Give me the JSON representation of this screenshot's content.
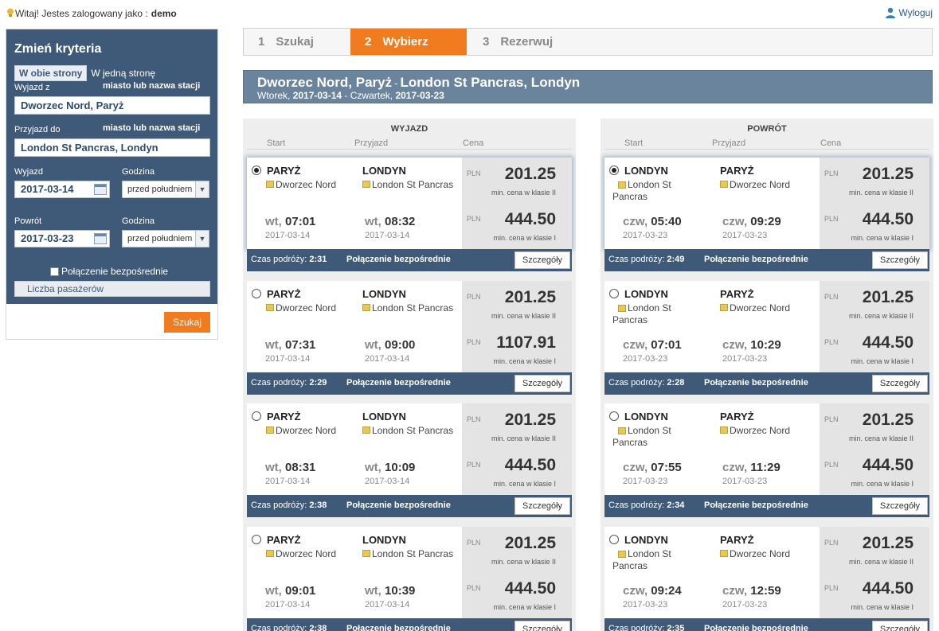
{
  "user_bar": {
    "welcome": "Witaj! Jestes zalogowany jako :",
    "username": "demo",
    "logout": "Wyloguj"
  },
  "sidebar": {
    "title": "Zmień kryteria",
    "trip_round": "W obie strony",
    "trip_oneway": "W jedną stronę",
    "from_label": "Wyjazd z",
    "from_hint": "miasto lub nazwa stacji",
    "from_value": "Dworzec Nord, Paryż",
    "to_label": "Przyjazd do",
    "to_hint": "miasto lub nazwa stacji",
    "to_value": "London St Pancras, Londyn",
    "depart_label": "Wyjazd",
    "depart_date": "2017-03-14",
    "depart_time_label": "Godzina",
    "depart_time": "przed południem",
    "return_label": "Powrót",
    "return_date": "2017-03-23",
    "return_time_label": "Godzina",
    "return_time": "przed południem",
    "direct_label": "Połączenie bezpośrednie",
    "passengers": "Liczba pasażerów",
    "search_button": "Szukaj"
  },
  "steps": [
    {
      "num": "1",
      "label": "Szukaj"
    },
    {
      "num": "2",
      "label": "Wybierz"
    },
    {
      "num": "3",
      "label": "Rezerwuj"
    }
  ],
  "route": {
    "from": "Dworzec Nord, Paryż",
    "sep": "-",
    "to": "London St Pancras, Londyn",
    "day1": "Wtorek,",
    "date1": "2017-03-14",
    "dash": "-",
    "day2": "Czwartek,",
    "date2": "2017-03-23"
  },
  "columns_header": {
    "start": "Start",
    "arrive": "Przyjazd",
    "price": "Cena"
  },
  "outbound": {
    "title": "WYJAZD",
    "from_city": "PARYŻ",
    "to_city": "LONDYN",
    "from_station": "Dworzec Nord",
    "to_station": "London St Pancras",
    "currency": "PLN",
    "class2": "min. cena w klasie II",
    "class1": "min. cena w klasie I",
    "duration_label": "Czas podróży:",
    "direct": "Połączenie bezpośrednie",
    "details": "Szczegóły",
    "trips": [
      {
        "dep_day": "wt,",
        "dep_time": "07:01",
        "dep_date": "2017-03-14",
        "arr_day": "wt,",
        "arr_time": "08:32",
        "arr_date": "2017-03-14",
        "price2": "201.25",
        "price1": "444.50",
        "duration": "2:31",
        "selected": true
      },
      {
        "dep_day": "wt,",
        "dep_time": "07:31",
        "dep_date": "2017-03-14",
        "arr_day": "wt,",
        "arr_time": "09:00",
        "arr_date": "2017-03-14",
        "price2": "201.25",
        "price1": "1107.91",
        "duration": "2:29",
        "selected": false
      },
      {
        "dep_day": "wt,",
        "dep_time": "08:31",
        "dep_date": "2017-03-14",
        "arr_day": "wt,",
        "arr_time": "10:09",
        "arr_date": "2017-03-14",
        "price2": "201.25",
        "price1": "444.50",
        "duration": "2:38",
        "selected": false
      },
      {
        "dep_day": "wt,",
        "dep_time": "09:01",
        "dep_date": "2017-03-14",
        "arr_day": "wt,",
        "arr_time": "10:39",
        "arr_date": "2017-03-14",
        "price2": "201.25",
        "price1": "444.50",
        "duration": "2:38",
        "selected": false
      }
    ]
  },
  "inbound": {
    "title": "POWRÓT",
    "from_city": "LONDYN",
    "to_city": "PARYŻ",
    "from_station_a": "London St",
    "from_station_b": "Pancras",
    "to_station": "Dworzec Nord",
    "currency": "PLN",
    "class2": "min. cena w klasie II",
    "class1": "min. cena w klasie I",
    "duration_label": "Czas podróży:",
    "direct": "Połączenie bezpośrednie",
    "details": "Szczegóły",
    "trips": [
      {
        "dep_day": "czw,",
        "dep_time": "05:40",
        "dep_date": "2017-03-23",
        "arr_day": "czw,",
        "arr_time": "09:29",
        "arr_date": "2017-03-23",
        "price2": "201.25",
        "price1": "444.50",
        "duration": "2:49",
        "selected": true
      },
      {
        "dep_day": "czw,",
        "dep_time": "07:01",
        "dep_date": "2017-03-23",
        "arr_day": "czw,",
        "arr_time": "10:29",
        "arr_date": "2017-03-23",
        "price2": "201.25",
        "price1": "444.50",
        "duration": "2:28",
        "selected": false
      },
      {
        "dep_day": "czw,",
        "dep_time": "07:55",
        "dep_date": "2017-03-23",
        "arr_day": "czw,",
        "arr_time": "11:29",
        "arr_date": "2017-03-23",
        "price2": "201.25",
        "price1": "444.50",
        "duration": "2:34",
        "selected": false
      },
      {
        "dep_day": "czw,",
        "dep_time": "09:24",
        "dep_date": "2017-03-23",
        "arr_day": "czw,",
        "arr_time": "12:59",
        "arr_date": "2017-03-23",
        "price2": "201.25",
        "price1": "444.50",
        "duration": "2:35",
        "selected": false
      }
    ]
  }
}
